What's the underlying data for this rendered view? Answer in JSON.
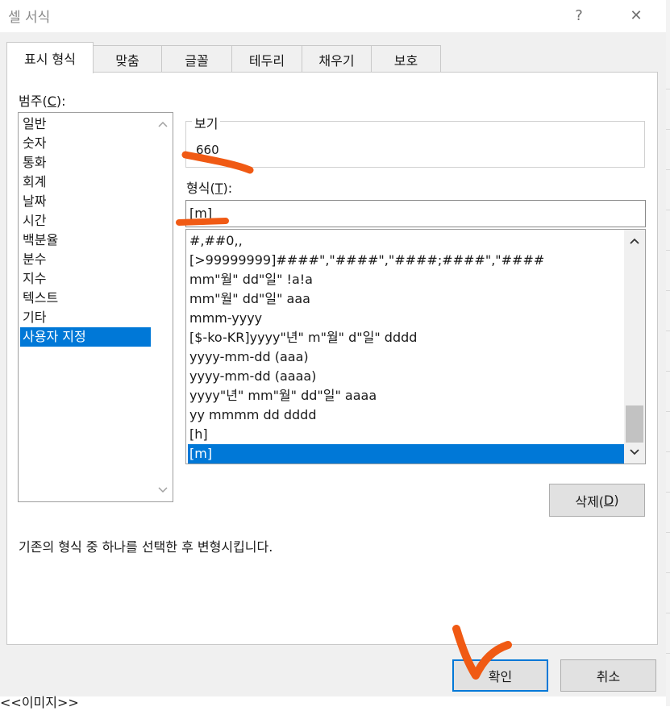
{
  "window": {
    "title": "셀 서식",
    "help_label": "?",
    "close_label": "✕"
  },
  "tabs": [
    {
      "label": "표시 형식",
      "active": true
    },
    {
      "label": "맞춤"
    },
    {
      "label": "글꼴"
    },
    {
      "label": "테두리"
    },
    {
      "label": "채우기"
    },
    {
      "label": "보호"
    }
  ],
  "category": {
    "label_prefix": "범주(",
    "label_key": "C",
    "label_suffix": "):",
    "items": [
      "일반",
      "숫자",
      "통화",
      "회계",
      "날짜",
      "시간",
      "백분율",
      "분수",
      "지수",
      "텍스트",
      "기타",
      "사용자 지정"
    ],
    "selected": "사용자 지정"
  },
  "sample": {
    "label": "보기",
    "value": "660"
  },
  "format": {
    "label_prefix": "형식(",
    "label_key": "T",
    "label_suffix": "):",
    "input_value": "[m]",
    "items": [
      "#,##0,,",
      "[>99999999]####\",\"####\",\"####;####\",\"####",
      "mm\"월\" dd\"일\" !a!a",
      "mm\"월\" dd\"일\" aaa",
      "mmm-yyyy",
      "[$-ko-KR]yyyy\"년\" m\"월\" d\"일\" dddd",
      "yyyy-mm-dd (aaa)",
      "yyyy-mm-dd (aaaa)",
      "yyyy\"년\" mm\"월\" dd\"일\" aaaa",
      "yy mmmm dd dddd",
      "[h]",
      "[m]"
    ],
    "selected": "[m]"
  },
  "delete_button": {
    "label_prefix": "삭제(",
    "label_key": "D",
    "label_suffix": ")"
  },
  "description": "기존의 형식 중 하나를 선택한 후 변형시킵니다.",
  "ok_button": "확인",
  "cancel_button": "취소",
  "background_text": "<<이미지>>",
  "colors": {
    "selection": "#0078d7",
    "annotation": "#f05a14"
  }
}
